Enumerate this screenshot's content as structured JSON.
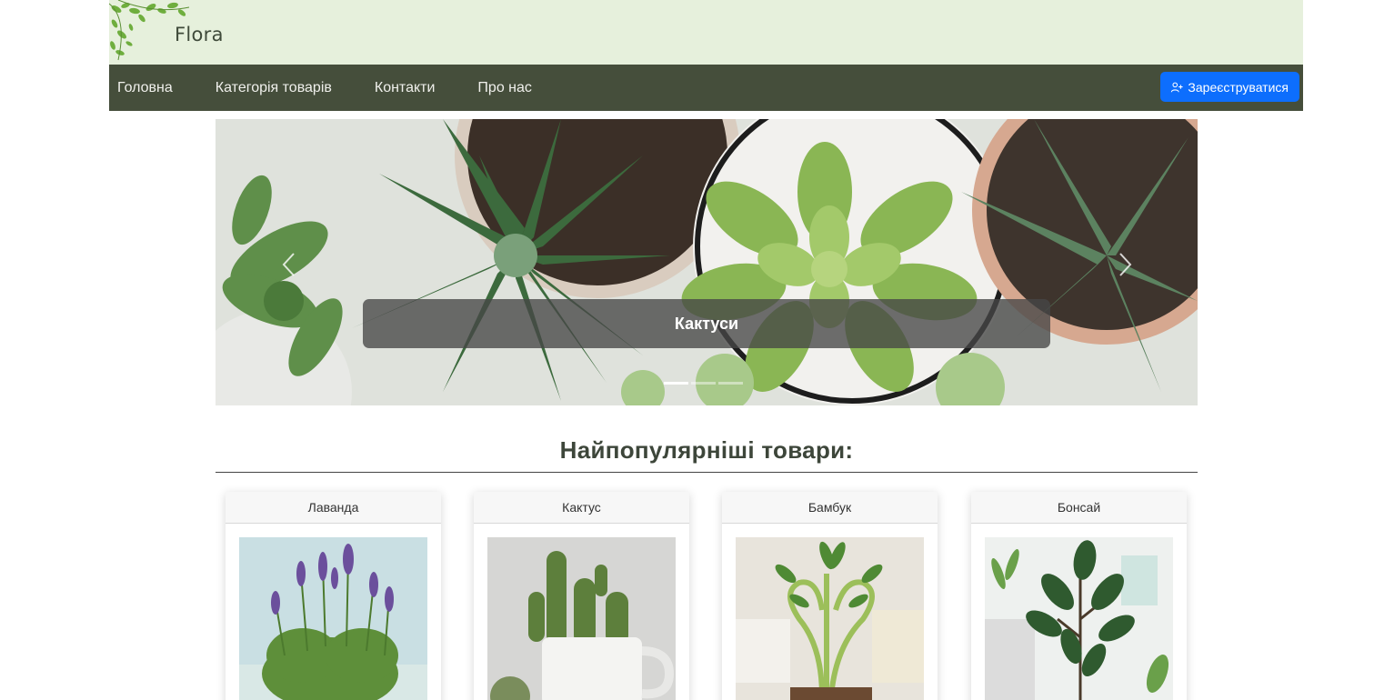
{
  "header": {
    "brand": "Flora"
  },
  "nav": {
    "items": [
      {
        "label": "Головна"
      },
      {
        "label": "Категорія товарів"
      },
      {
        "label": "Контакти"
      },
      {
        "label": "Про нас"
      }
    ],
    "register_label": "Зареєструватися"
  },
  "carousel": {
    "caption": "Кактуси",
    "slide_count": 3,
    "active_index": 0
  },
  "popular": {
    "title": "Найпопулярніші товари:",
    "products": [
      {
        "name": "Лаванда"
      },
      {
        "name": "Кактус"
      },
      {
        "name": "Бамбук"
      },
      {
        "name": "Бонсай"
      }
    ]
  },
  "colors": {
    "header_bg": "#e6f0dc",
    "nav_bg": "#454e3b",
    "accent": "#0d6efd"
  }
}
